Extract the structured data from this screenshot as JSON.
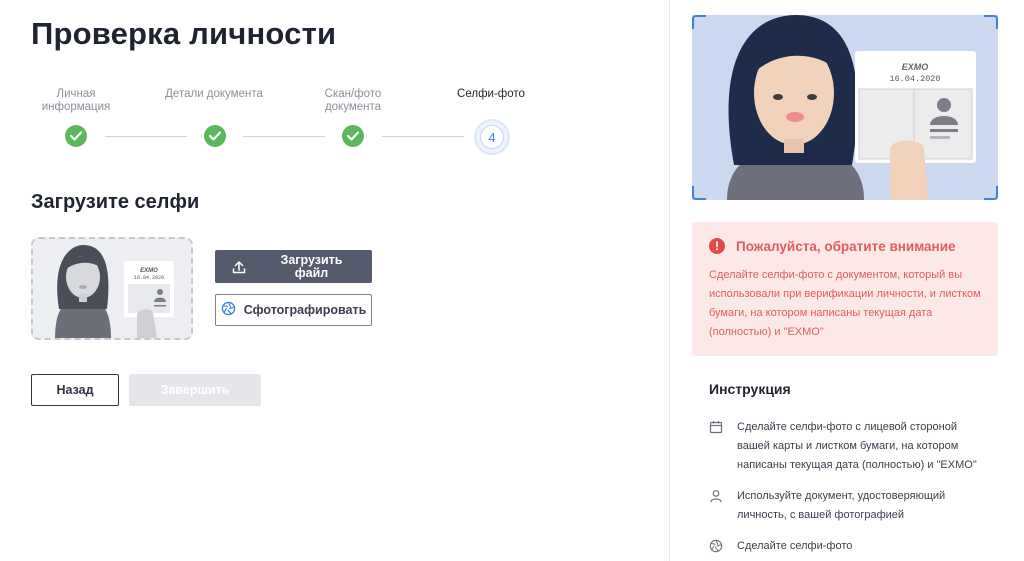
{
  "page": {
    "title": "Проверка личности"
  },
  "stepper": {
    "steps": [
      {
        "label": "Личная информация",
        "status": "done"
      },
      {
        "label": "Детали документа",
        "status": "done"
      },
      {
        "label": "Скан/фото документа",
        "status": "done"
      },
      {
        "label": "Селфи-фото",
        "status": "current",
        "number": "4"
      }
    ]
  },
  "upload": {
    "section_title": "Загрузите селфи",
    "upload_button": "Загрузить файл",
    "photo_button": "Сфотографировать",
    "card_brand": "EXMO",
    "card_date": "16.04.2020"
  },
  "nav": {
    "back_label": "Назад",
    "finish_label": "Завершить"
  },
  "hero": {
    "card_brand": "EXMO",
    "card_date": "16.04.2020"
  },
  "alert": {
    "title": "Пожалуйста, обратите внимание",
    "text": "Сделайте селфи-фото с документом, который вы использовали при верификации личности, и листком бумаги, на котором написаны текущая дата (полностью) и \"EXMO\""
  },
  "instructions": {
    "title": "Инструкция",
    "items": [
      {
        "icon": "calendar-icon",
        "text": "Сделайте селфи-фото с лицевой стороной вашей карты и листком бумаги, на котором написаны текущая дата (полностью) и \"EXMO\""
      },
      {
        "icon": "user-icon",
        "text": "Используйте документ, удостоверяющий личность, с вашей фотографией"
      },
      {
        "icon": "camera-aperture-icon",
        "text": "Сделайте селфи-фото"
      }
    ]
  },
  "colors": {
    "success": "#5cb85c",
    "accent": "#4a84d8",
    "alert": "#e25d5d",
    "primary_button": "#555a6d"
  }
}
